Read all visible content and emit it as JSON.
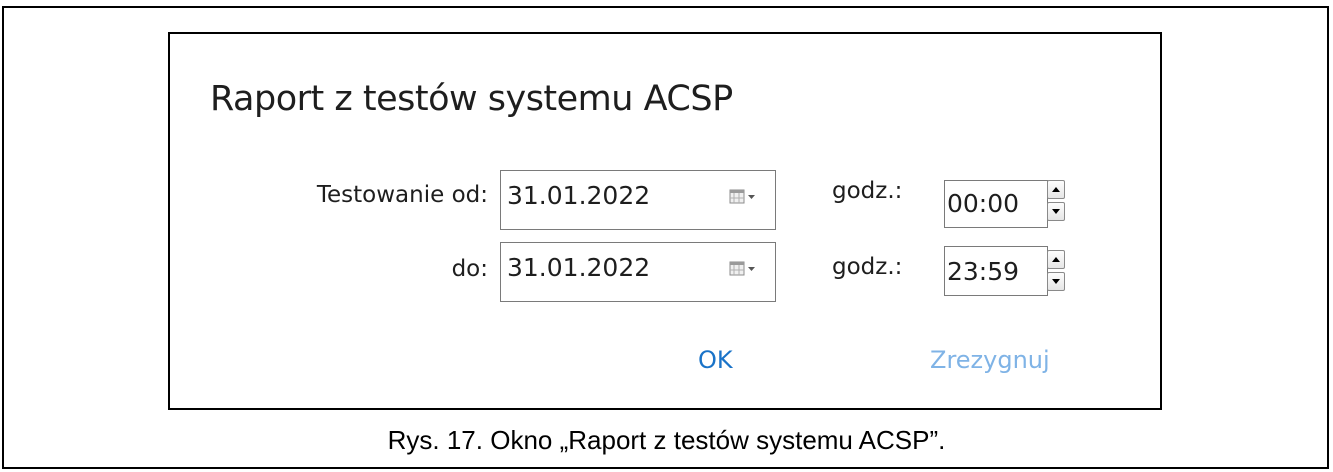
{
  "dialog": {
    "title": "Raport z testów systemu ACSP",
    "rows": [
      {
        "label": "Testowanie od:",
        "date": "31.01.2022",
        "time_label": "godz.:",
        "time": "00:00"
      },
      {
        "label": "do:",
        "date": "31.01.2022",
        "time_label": "godz.:",
        "time": "23:59"
      }
    ],
    "ok_label": "OK",
    "cancel_label": "Zrezygnuj"
  },
  "caption": "Rys. 17. Okno „Raport z testów systemu ACSP”.",
  "colors": {
    "ok": "#1a73c8",
    "cancel": "#7fb3e6",
    "text": "#1e1e1e",
    "border": "#7a7a7a"
  },
  "icons": [
    "calendar-dropdown-icon",
    "spin-up-icon",
    "spin-down-icon"
  ]
}
